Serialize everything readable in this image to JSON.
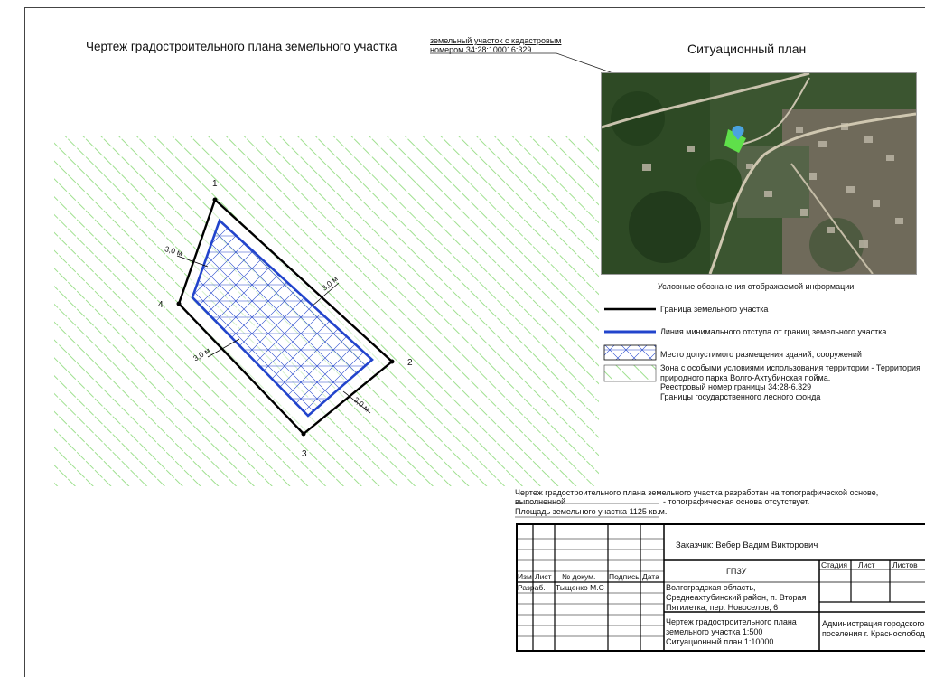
{
  "drawing": {
    "title": "Чертеж градостроительного плана земельного участка",
    "callout_line1": "земельный участок с кадастровым",
    "callout_line2": "номером 34:28:100016:329",
    "points": [
      "1",
      "2",
      "3",
      "4"
    ],
    "offset_labels": [
      "3,0 м",
      "3,0 м",
      "3,0 м",
      "3,0 м"
    ]
  },
  "situation": {
    "title": "Ситуационный план"
  },
  "legend": {
    "title": "Условные обозначения отображаемой информации",
    "items": [
      "Граница земельного участка",
      "Линия минимального отступа от границ земельного участка",
      "Место допустимого размещения зданий, сооружений",
      "Зона с особыми условиями использования территории - Территория",
      "природного парка Волго-Ахтубинская пойма.",
      "Реестровый номер границы 34:28-6.329",
      "Границы государственного лесного фонда"
    ]
  },
  "notes": {
    "line1": "Чертеж градостроительного плана земельного участка разработан на топографической основе, выполненной",
    "line2": "- топографическая основа отсутствует.",
    "area": "Площадь земельного участка 1125 кв.м."
  },
  "stamp": {
    "customer": "Заказчик: Вебер Вадим Викторович",
    "doc_code": "ГПЗУ",
    "col_headers": [
      "Изм",
      "Лист",
      "№ докум.",
      "Подпись",
      "Дата"
    ],
    "stage_headers": [
      "Стадия",
      "Лист",
      "Листов"
    ],
    "role": "Разраб.",
    "author": "Тыщенко М.С",
    "address": [
      "Волгоградская область,",
      "Среднеахтубинский район, п. Вторая",
      "Пятилетка, пер. Новоселов, 6"
    ],
    "sheet_title": [
      "Чертеж градостроительного плана",
      "земельного участка 1:500",
      "Ситуационный план 1:10000"
    ],
    "org": [
      "Администрация городского",
      "поселения г. Краснослободск"
    ]
  },
  "colors": {
    "parcel_boundary": "#000000",
    "setback_line": "#2244cc",
    "zone_hatch": "#9fe08f",
    "map_green_parcel": "#5fe04a"
  }
}
